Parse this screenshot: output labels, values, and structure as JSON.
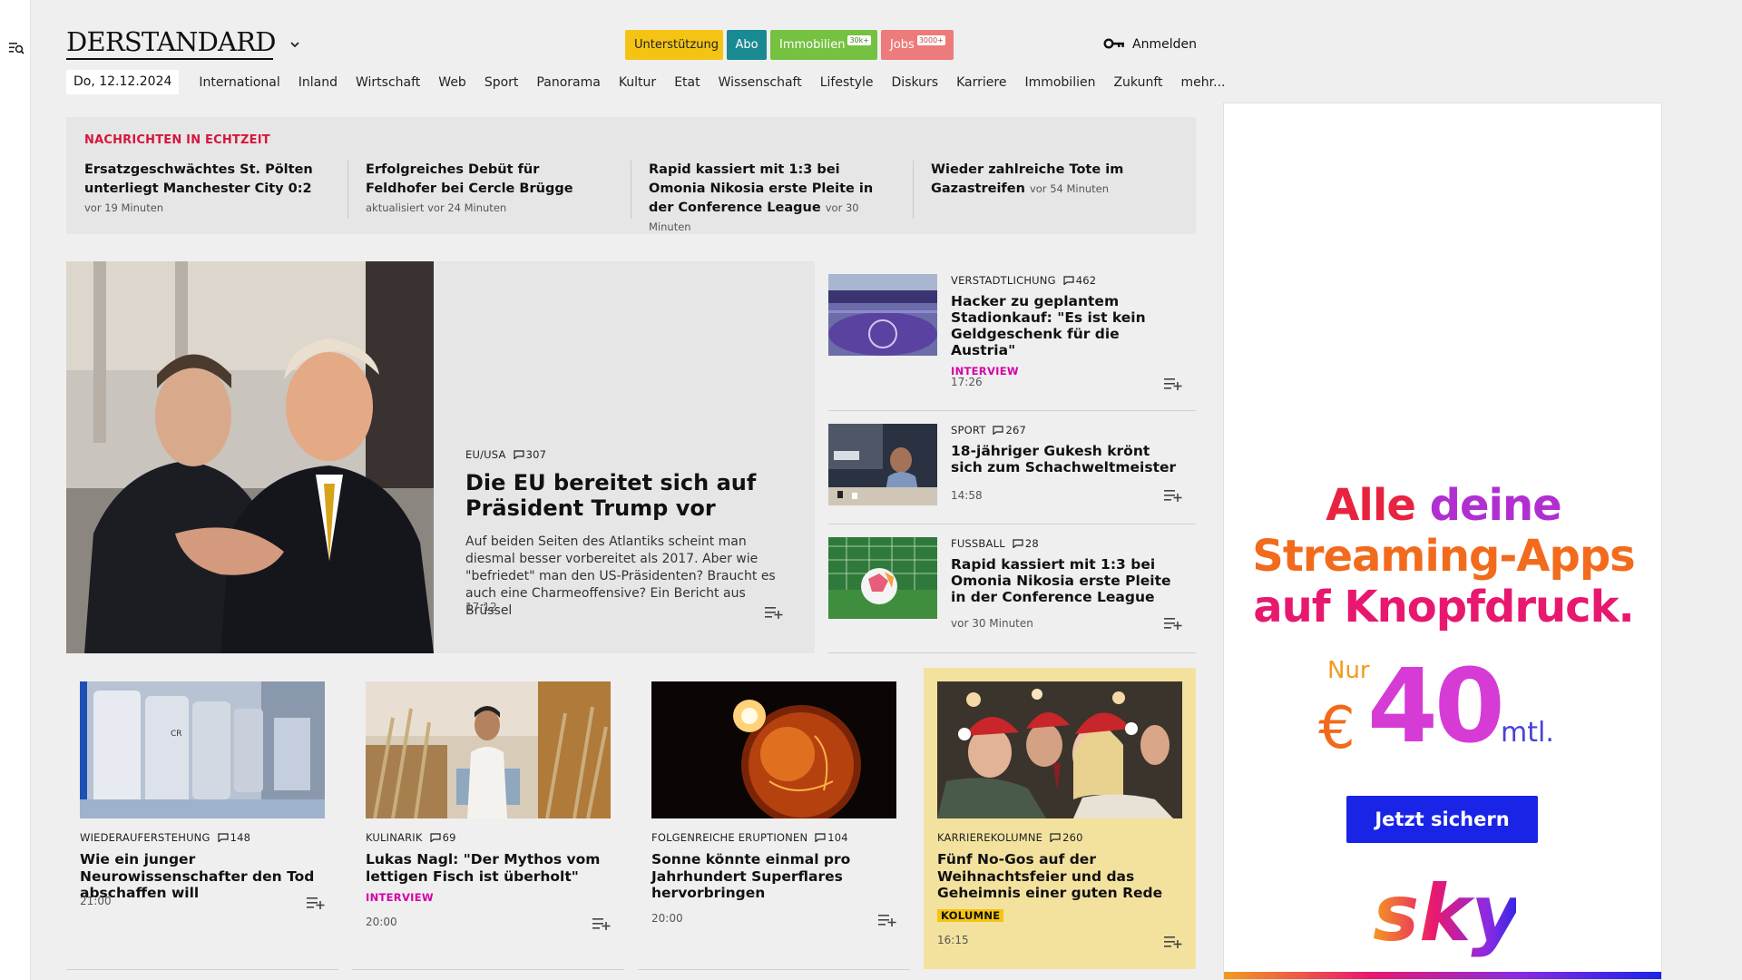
{
  "header": {
    "logo": "DERSTANDARD",
    "pills": {
      "support": "Unterstützung",
      "abo": "Abo",
      "immobilien": "Immobilien",
      "immobilien_tag": "30k+",
      "jobs": "Jobs",
      "jobs_tag": "3000+"
    },
    "login": "Anmelden"
  },
  "nav": {
    "date": "Do, 12.12.2024",
    "items": [
      "International",
      "Inland",
      "Wirtschaft",
      "Web",
      "Sport",
      "Panorama",
      "Kultur",
      "Etat",
      "Wissenschaft",
      "Lifestyle",
      "Diskurs",
      "Karriere",
      "Immobilien",
      "Zukunft",
      "mehr..."
    ]
  },
  "live": {
    "title": "NACHRICHTEN IN ECHTZEIT",
    "items": [
      {
        "text": "Ersatzgeschwächtes St. Pölten unter­liegt Manchester City 0:2",
        "time": "vor 19 Minuten"
      },
      {
        "text": "Erfolgreiches Debüt für Feldhofer bei Cercle Brügge",
        "time": "aktualisiert vor 24 Minuten"
      },
      {
        "text": "Rapid kassiert mit 1:3 bei Omonia Ni­kosia erste Pleite in der Conference League",
        "time": "vor 30 Minuten"
      },
      {
        "text": "Wieder zahlreiche Tote im Gazastrei­fen",
        "time": "vor 54 Minuten"
      }
    ]
  },
  "hero": {
    "kicker": "EU/USA",
    "comments": "307",
    "title": "Die EU bereitet sich auf Präsident Trump vor",
    "teaser": "Auf beiden Seiten des Atlantiks scheint man diesmal besser vorbereitet als 2017. Aber wie \"befriedet\" man den US-Präsidenten? Braucht es auch eine Charmeoffensive? Ein Bericht aus Brüssel",
    "time": "17:12"
  },
  "side": [
    {
      "kicker": "VERSTADTLICHUNG",
      "comments": "462",
      "title": "Hacker zu geplantem Stadionkauf: \"Es ist kein Geldgeschenk für die Austria\"",
      "tag": "INTERVIEW",
      "time": "17:26"
    },
    {
      "kicker": "SPORT",
      "comments": "267",
      "title": "18-jähriger Gukesh krönt sich zum Schachweltmeister",
      "time": "14:58"
    },
    {
      "kicker": "FUSSBALL",
      "comments": "28",
      "title": "Rapid kassiert mit 1:3 bei Omonia Nikosia erste Pleite in der Conference League",
      "time": "vor 30 Minuten"
    }
  ],
  "cards": [
    {
      "kicker": "WIEDERAUFERSTEHUNG",
      "comments": "148",
      "title": "Wie ein junger Neurowissenschaf­ter den Tod abschaffen will",
      "time": "21:00"
    },
    {
      "kicker": "KULINARIK",
      "comments": "69",
      "title": "Lukas Nagl: \"Der Mythos vom lettigen Fisch ist überholt\"",
      "tag": "INTERVIEW",
      "time": "20:00"
    },
    {
      "kicker": "FOLGENREICHE ERUPTIONEN",
      "comments": "104",
      "title": "Sonne könnte einmal pro Jahrhundert Superflares hervorbringen",
      "time": "20:00"
    },
    {
      "kicker": "KARRIEREKOLUMNE",
      "comments": "260",
      "title": "Fünf No-Gos auf der Weihnachts­feier und das Geheimnis einer guten Rede",
      "tag": "KOLUMNE",
      "time": "16:15"
    }
  ],
  "ad": {
    "line1a": "Alle",
    "line1b": "deine",
    "line2": "Streaming-Apps",
    "line3": "auf Knopfdruck.",
    "nur": "Nur",
    "currency": "€",
    "price": "40",
    "per": "mtl.",
    "cta": "Jetzt sichern",
    "brand": "sky"
  },
  "colors": {
    "accent_red": "#d6163d",
    "interview": "#d600a8",
    "abo": "#1a8a92",
    "support": "#f5c314",
    "highlight_card": "#f3e29d"
  }
}
